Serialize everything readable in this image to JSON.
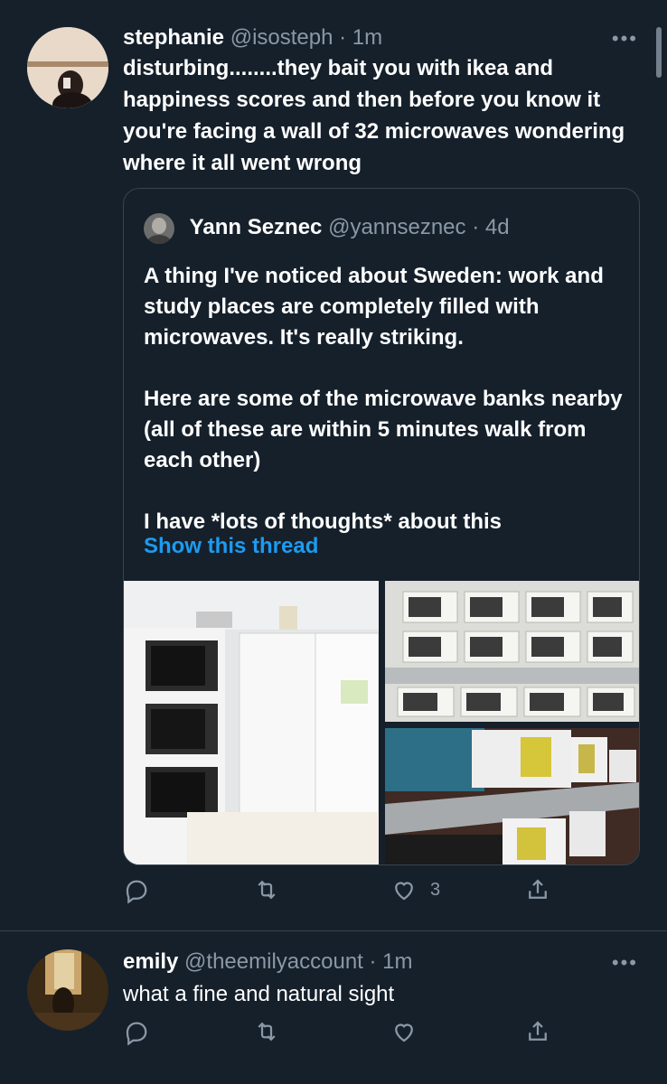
{
  "tweet1": {
    "display_name": "stephanie",
    "handle": "@isosteph",
    "time": "· 1m",
    "text": "disturbing........they bait you with ikea and happiness scores and then before you know it you're facing a wall of 32 microwaves wondering where it all went wrong",
    "quoted": {
      "display_name": "Yann Seznec",
      "handle": "@yannseznec",
      "time": "· 4d",
      "text": "A thing I've noticed about Sweden: work and study places are completely filled with microwaves. It's really striking.\n\nHere are some of the microwave banks nearby (all of these are within 5 minutes walk from each other)\n\nI have *lots of thoughts* about this",
      "show_thread": "Show this thread"
    },
    "actions": {
      "like_count": "3"
    }
  },
  "tweet2": {
    "display_name": "emily",
    "handle": "@theemilyaccount",
    "time": "· 1m",
    "text": "what a fine and natural sight",
    "actions": {
      "like_count": ""
    }
  },
  "icons": [
    "more-icon",
    "reply-icon",
    "retweet-icon",
    "like-icon",
    "share-icon"
  ],
  "colors": {
    "background": "#15202b",
    "muted": "#8b98a5",
    "link": "#1d9bf0",
    "border": "#38444d"
  }
}
